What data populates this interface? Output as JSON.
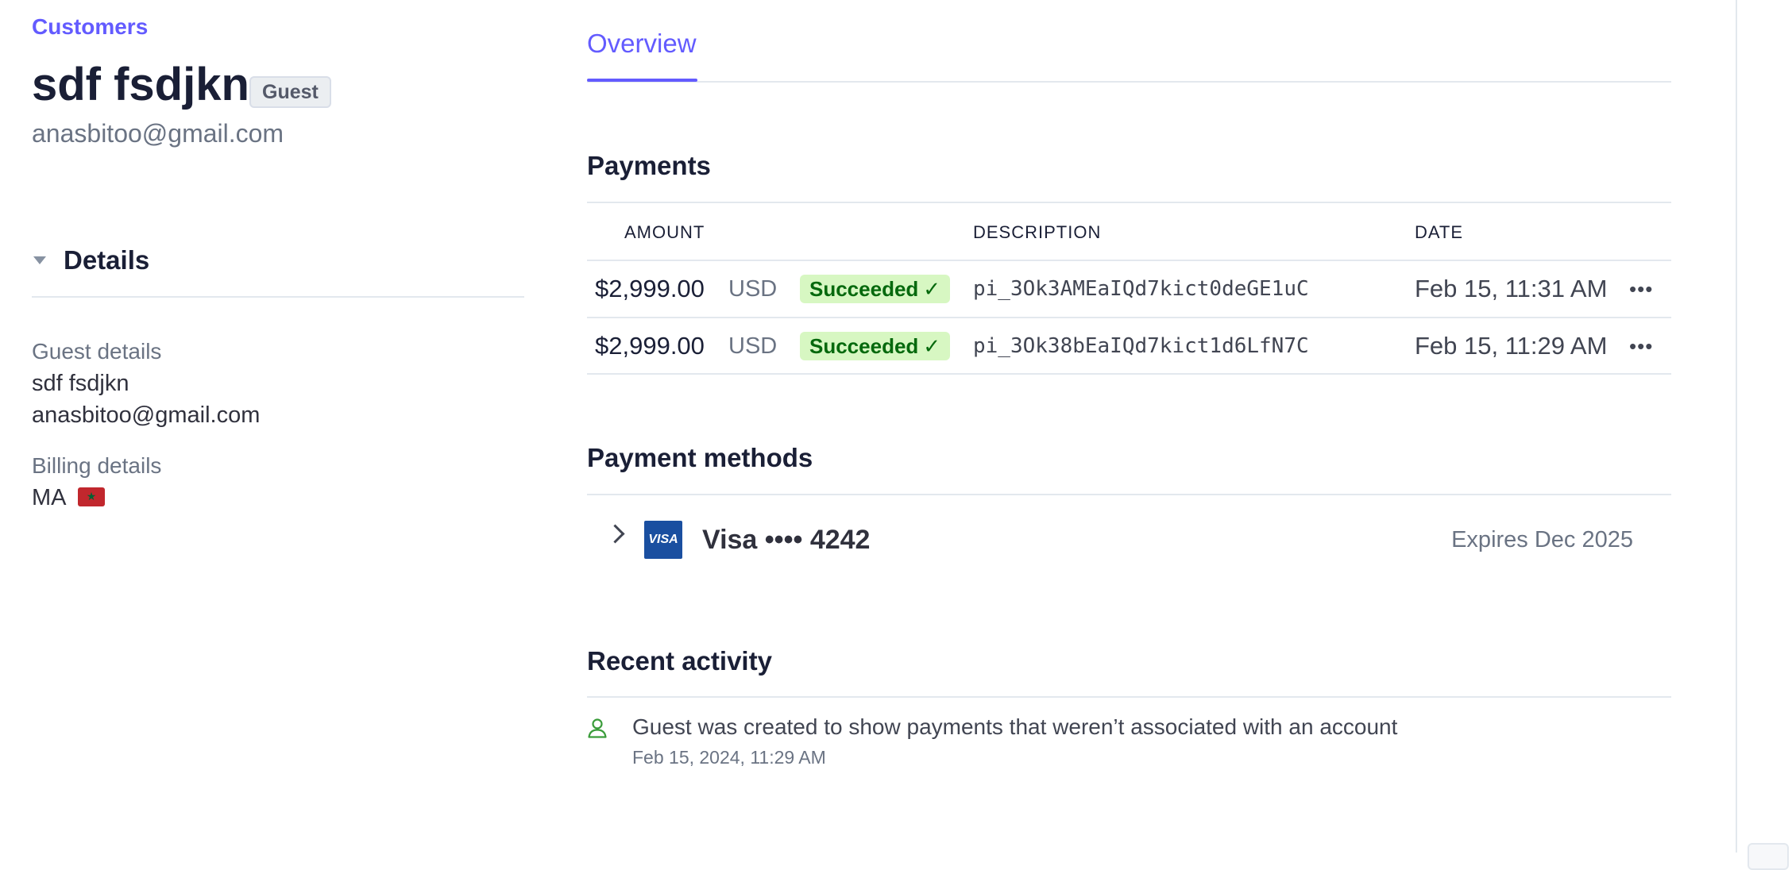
{
  "breadcrumb": "Customers",
  "customer": {
    "name": "sdf fsdjkn",
    "badge": "Guest",
    "email": "anasbitoo@gmail.com"
  },
  "details": {
    "title": "Details",
    "guest_label": "Guest details",
    "guest_name": "sdf fsdjkn",
    "guest_email": "anasbitoo@gmail.com",
    "billing_label": "Billing details",
    "billing_country": "MA",
    "flag_icon": "morocco-flag-icon"
  },
  "tabs": [
    {
      "label": "Overview",
      "active": true
    }
  ],
  "payments": {
    "title": "Payments",
    "columns": {
      "amount": "AMOUNT",
      "description": "DESCRIPTION",
      "date": "DATE"
    },
    "rows": [
      {
        "amount": "$2,999.00",
        "currency": "USD",
        "status": "Succeeded",
        "description": "pi_3Ok3AMEaIQd7kict0deGE1uC",
        "date": "Feb 15, 11:31 AM"
      },
      {
        "amount": "$2,999.00",
        "currency": "USD",
        "status": "Succeeded",
        "description": "pi_3Ok38bEaIQd7kict1d6LfN7C",
        "date": "Feb 15, 11:29 AM"
      }
    ],
    "status_color": "#d7f7c2",
    "more_icon": "ellipsis-icon"
  },
  "payment_methods": {
    "title": "Payment methods",
    "card_brand_icon": "visa-card-icon",
    "card_brand_text": "VISA",
    "card_label": "Visa •••• 4242",
    "expiry": "Expires Dec 2025"
  },
  "recent_activity": {
    "title": "Recent activity",
    "items": [
      {
        "icon": "user-icon",
        "text": "Guest was created to show payments that weren’t associated with an account",
        "time": "Feb 15, 2024, 11:29 AM"
      }
    ]
  },
  "colors": {
    "accent": "#635bff",
    "text": "#1a1f36",
    "muted": "#6a7383"
  }
}
